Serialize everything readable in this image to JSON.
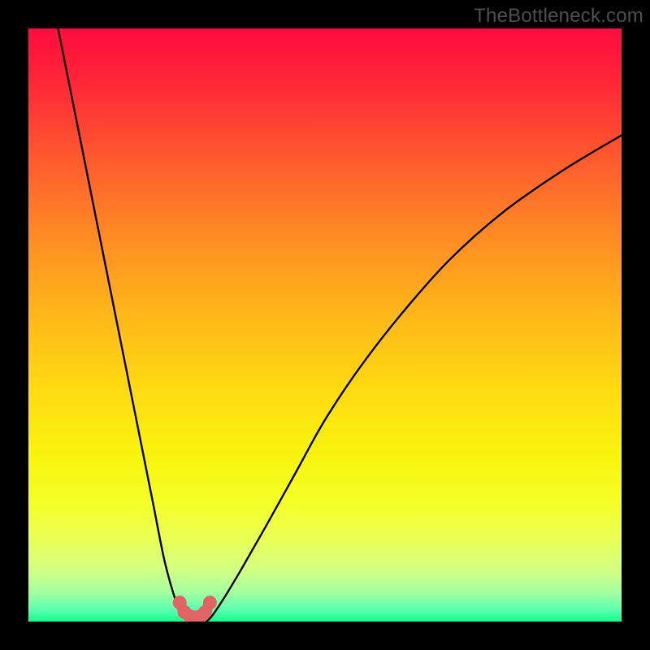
{
  "watermark": "TheBottleneck.com",
  "chart_data": {
    "type": "line",
    "title": "",
    "xlabel": "",
    "ylabel": "",
    "xlim": [
      0,
      100
    ],
    "ylim": [
      0,
      100
    ],
    "series": [
      {
        "name": "left-curve",
        "x": [
          5,
          7,
          9,
          11,
          13,
          15,
          17,
          19,
          21,
          23,
          25,
          26,
          27
        ],
        "y": [
          100,
          90,
          80,
          70,
          60,
          50,
          40,
          30,
          20,
          10,
          3,
          1,
          0
        ]
      },
      {
        "name": "right-curve",
        "x": [
          30,
          31,
          33,
          36,
          40,
          45,
          50,
          56,
          63,
          71,
          80,
          90,
          100
        ],
        "y": [
          0,
          1,
          4,
          9,
          16,
          25,
          34,
          43,
          52,
          61,
          69,
          76,
          82
        ]
      },
      {
        "name": "optimal-band-markers",
        "x": [
          25.5,
          26.3,
          27.2,
          28.1,
          29.0,
          29.8,
          30.6
        ],
        "y": [
          3.2,
          1.6,
          0.9,
          0.7,
          0.9,
          1.6,
          3.2
        ]
      }
    ],
    "gradient_stops": [
      {
        "offset": 0.0,
        "color": "#ff0b3e"
      },
      {
        "offset": 0.1,
        "color": "#ff2a38"
      },
      {
        "offset": 0.22,
        "color": "#ff5a2e"
      },
      {
        "offset": 0.35,
        "color": "#ff8b24"
      },
      {
        "offset": 0.48,
        "color": "#ffb61a"
      },
      {
        "offset": 0.6,
        "color": "#ffd812"
      },
      {
        "offset": 0.72,
        "color": "#f8f40e"
      },
      {
        "offset": 0.8,
        "color": "#f4ff27"
      },
      {
        "offset": 0.86,
        "color": "#eaff55"
      },
      {
        "offset": 0.91,
        "color": "#d4ff80"
      },
      {
        "offset": 0.95,
        "color": "#a6ffa0"
      },
      {
        "offset": 0.98,
        "color": "#5cffb0"
      },
      {
        "offset": 1.0,
        "color": "#16ff8a"
      }
    ],
    "marker_color": "#e16363",
    "curve_color": "#000000"
  }
}
